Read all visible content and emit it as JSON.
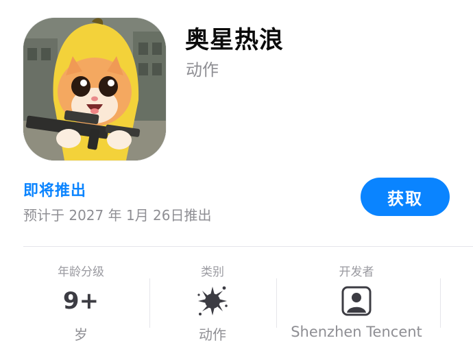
{
  "app": {
    "name": "奥星热浪",
    "genre": "动作",
    "icon": "banana-cat-with-gun-icon"
  },
  "release": {
    "status": "即将推出",
    "date_text": "预计于 2027 年 1月 26日推出"
  },
  "actions": {
    "get_label": "获取"
  },
  "info": {
    "age": {
      "header": "年龄分级",
      "value": "9+",
      "sub": "岁"
    },
    "category": {
      "header": "类别",
      "icon": "action-splash-icon",
      "sub": "动作"
    },
    "developer": {
      "header": "开发者",
      "icon": "person-square-icon",
      "name": "Shenzhen Tencent"
    }
  },
  "colors": {
    "accent": "#0a84ff",
    "secondary_text": "#8e8e93",
    "divider": "#e5e5ea"
  }
}
